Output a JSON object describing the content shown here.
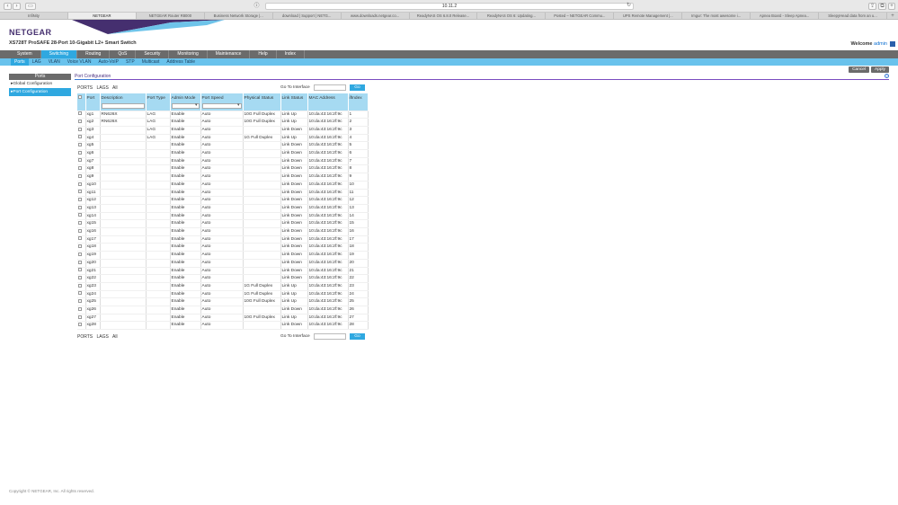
{
  "browser": {
    "url": "10.11.2",
    "tabs": [
      "InfiNity",
      "NETGEAR",
      "NETGEAR Router R8000",
      "Business Network Storage |...",
      "download | Support | NETG...",
      "www.downloads.netgear.co...",
      "ReadyNAS OS 6.8.0 Release...",
      "ReadyNAS OS 6: Updating...",
      "Posted – NETGEAR Commu...",
      "UPS Remote Management |...",
      "Imgur: The most awesome i...",
      "Apnea Board - Sleep Apnea...",
      "SleepyHead data from an u..."
    ],
    "active_tab": 1
  },
  "header": {
    "logo": "NETGEAR",
    "product": "XS728T ProSAFE 28-Port 10-Gigabit L2+ Smart Switch",
    "welcome": "Welcome",
    "user": "admin"
  },
  "mainnav": [
    "System",
    "Switching",
    "Routing",
    "QoS",
    "Security",
    "Monitoring",
    "Maintenance",
    "Help",
    "Index"
  ],
  "mainnav_active": 1,
  "subnav": [
    "Ports",
    "LAG",
    "VLAN",
    "Voice VLAN",
    "Auto-VoIP",
    "STP",
    "Multicast",
    "Address Table"
  ],
  "subnav_active": 0,
  "actions": {
    "cancel": "Cancel",
    "apply": "Apply"
  },
  "leftnav": {
    "head": "Ports",
    "items": [
      "Global Configuration",
      "Port Configuration"
    ],
    "active": 1
  },
  "panel": {
    "title": "Port Configuration",
    "filter_links": [
      "PORTS",
      "LAGS",
      "All"
    ],
    "goto_label": "Go To Interface",
    "go": "Go"
  },
  "table": {
    "columns": [
      "",
      "Port",
      "Description",
      "Port Type",
      "Admin Mode",
      "Port Speed",
      "Physical Status",
      "Link Status",
      "MAC Address",
      "ifIndex"
    ],
    "rows": [
      [
        "xg1",
        "RN626X",
        "LAG",
        "Enable",
        "Auto",
        "10G Full Duplex",
        "Link Up",
        "10:da:43:16:2f:9c",
        "1"
      ],
      [
        "xg2",
        "RN626X",
        "LAG",
        "Enable",
        "Auto",
        "10G Full Duplex",
        "Link Up",
        "10:da:43:16:2f:9c",
        "2"
      ],
      [
        "xg3",
        "",
        "LAG",
        "Enable",
        "Auto",
        "",
        "Link Down",
        "10:da:43:16:2f:9c",
        "3"
      ],
      [
        "xg4",
        "",
        "LAG",
        "Enable",
        "Auto",
        "1G Full Duplex",
        "Link Up",
        "10:da:43:16:2f:9c",
        "4"
      ],
      [
        "xg5",
        "",
        "",
        "Enable",
        "Auto",
        "",
        "Link Down",
        "10:da:43:16:2f:9c",
        "5"
      ],
      [
        "xg6",
        "",
        "",
        "Enable",
        "Auto",
        "",
        "Link Down",
        "10:da:43:16:2f:9c",
        "6"
      ],
      [
        "xg7",
        "",
        "",
        "Enable",
        "Auto",
        "",
        "Link Down",
        "10:da:43:16:2f:9c",
        "7"
      ],
      [
        "xg8",
        "",
        "",
        "Enable",
        "Auto",
        "",
        "Link Down",
        "10:da:43:16:2f:9c",
        "8"
      ],
      [
        "xg9",
        "",
        "",
        "Enable",
        "Auto",
        "",
        "Link Down",
        "10:da:43:16:2f:9c",
        "9"
      ],
      [
        "xg10",
        "",
        "",
        "Enable",
        "Auto",
        "",
        "Link Down",
        "10:da:43:16:2f:9c",
        "10"
      ],
      [
        "xg11",
        "",
        "",
        "Enable",
        "Auto",
        "",
        "Link Down",
        "10:da:43:16:2f:9c",
        "11"
      ],
      [
        "xg12",
        "",
        "",
        "Enable",
        "Auto",
        "",
        "Link Down",
        "10:da:43:16:2f:9c",
        "12"
      ],
      [
        "xg13",
        "",
        "",
        "Enable",
        "Auto",
        "",
        "Link Down",
        "10:da:43:16:2f:9c",
        "13"
      ],
      [
        "xg14",
        "",
        "",
        "Enable",
        "Auto",
        "",
        "Link Down",
        "10:da:43:16:2f:9c",
        "14"
      ],
      [
        "xg15",
        "",
        "",
        "Enable",
        "Auto",
        "",
        "Link Down",
        "10:da:43:16:2f:9c",
        "15"
      ],
      [
        "xg16",
        "",
        "",
        "Enable",
        "Auto",
        "",
        "Link Down",
        "10:da:43:16:2f:9c",
        "16"
      ],
      [
        "xg17",
        "",
        "",
        "Enable",
        "Auto",
        "",
        "Link Down",
        "10:da:43:16:2f:9c",
        "17"
      ],
      [
        "xg18",
        "",
        "",
        "Enable",
        "Auto",
        "",
        "Link Down",
        "10:da:43:16:2f:9c",
        "18"
      ],
      [
        "xg19",
        "",
        "",
        "Enable",
        "Auto",
        "",
        "Link Down",
        "10:da:43:16:2f:9c",
        "19"
      ],
      [
        "xg20",
        "",
        "",
        "Enable",
        "Auto",
        "",
        "Link Down",
        "10:da:43:16:2f:9c",
        "20"
      ],
      [
        "xg21",
        "",
        "",
        "Enable",
        "Auto",
        "",
        "Link Down",
        "10:da:43:16:2f:9c",
        "21"
      ],
      [
        "xg22",
        "",
        "",
        "Enable",
        "Auto",
        "",
        "Link Down",
        "10:da:43:16:2f:9c",
        "22"
      ],
      [
        "xg23",
        "",
        "",
        "Enable",
        "Auto",
        "1G Full Duplex",
        "Link Up",
        "10:da:43:16:2f:9c",
        "23"
      ],
      [
        "xg24",
        "",
        "",
        "Enable",
        "Auto",
        "1G Full Duplex",
        "Link Up",
        "10:da:43:16:2f:9c",
        "24"
      ],
      [
        "xg25",
        "",
        "",
        "Enable",
        "Auto",
        "10G Full Duplex",
        "Link Up",
        "10:da:43:16:2f:9c",
        "25"
      ],
      [
        "xg26",
        "",
        "",
        "Enable",
        "Auto",
        "",
        "Link Down",
        "10:da:43:16:2f:9c",
        "26"
      ],
      [
        "xg27",
        "",
        "",
        "Enable",
        "Auto",
        "10G Full Duplex",
        "Link Up",
        "10:da:43:16:2f:9c",
        "27"
      ],
      [
        "xg28",
        "",
        "",
        "Enable",
        "Auto",
        "",
        "Link Down",
        "10:da:43:16:2f:9c",
        "28"
      ]
    ]
  },
  "footer": "Copyright © NETGEAR, Inc. All rights reserved.",
  "colors": {
    "accent": "#2fa8e0",
    "brand": "#452f6f",
    "nav": "#6b6b6b"
  }
}
